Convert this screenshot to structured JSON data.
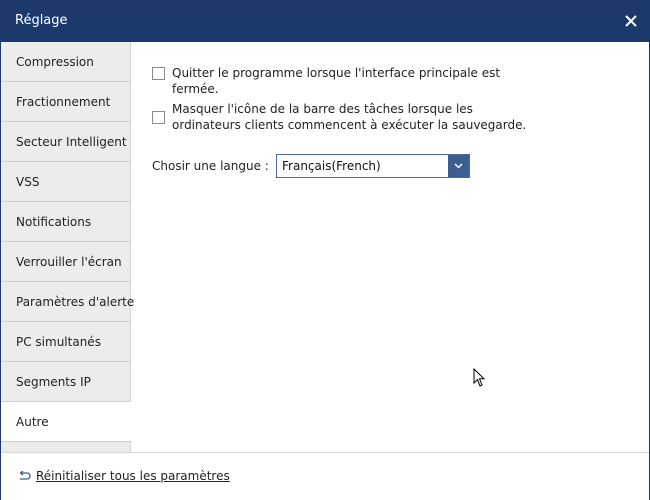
{
  "window": {
    "title": "Réglage"
  },
  "sidebar": {
    "items": [
      {
        "label": "Compression"
      },
      {
        "label": "Fractionnement"
      },
      {
        "label": "Secteur Intelligent"
      },
      {
        "label": "VSS"
      },
      {
        "label": "Notifications"
      },
      {
        "label": "Verrouiller l'écran"
      },
      {
        "label": "Paramètres d'alerte"
      },
      {
        "label": "PC simultanés"
      },
      {
        "label": "Segments IP"
      },
      {
        "label": "Autre"
      }
    ],
    "active_index": 9
  },
  "content": {
    "options": [
      {
        "label": "Quitter le programme lorsque l'interface principale est fermée.",
        "checked": false
      },
      {
        "label": "Masquer l'icône de la barre des tâches lorsque les ordinateurs clients commencent à exécuter la sauvegarde.",
        "checked": false
      }
    ],
    "language": {
      "label": "Chosir une langue :",
      "selected": "Français(French)"
    }
  },
  "footer": {
    "reset_label": "Réinitialiser tous les paramètres"
  },
  "colors": {
    "titlebar": "#1b3a6b",
    "accent": "#3b5d8f",
    "sidebar_bg": "#ececec"
  },
  "icons": {
    "close": "close-icon",
    "dropdown": "chevron-down-icon",
    "reset": "undo-arrow-icon",
    "cursor": "mouse-cursor-icon"
  }
}
